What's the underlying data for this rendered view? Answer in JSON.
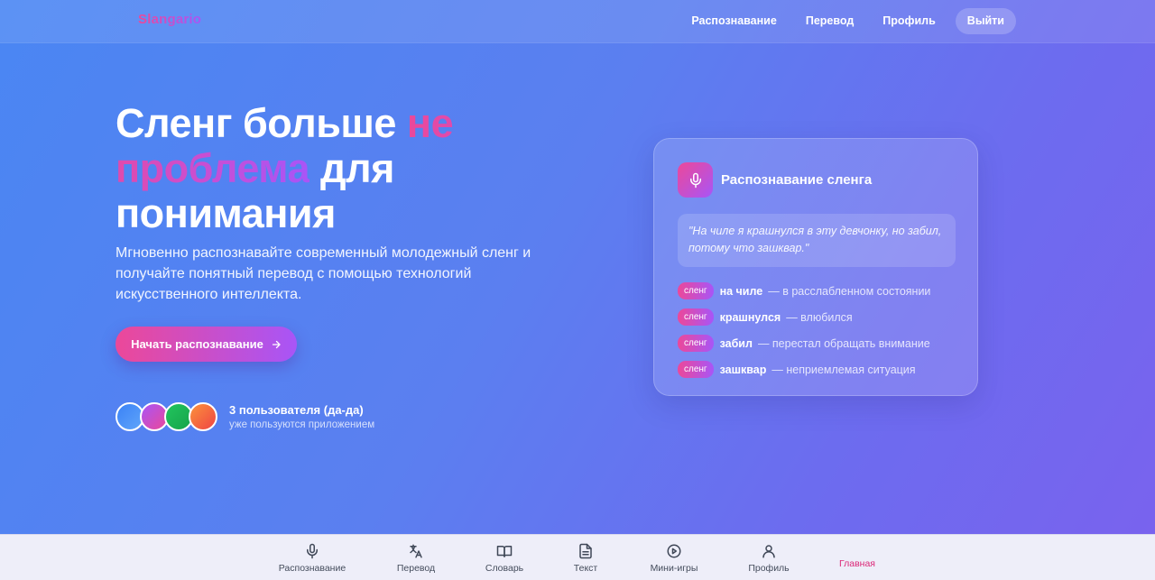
{
  "app": {
    "logo": "Slangario"
  },
  "topnav": {
    "links": [
      "Распознавание",
      "Перевод",
      "Профиль"
    ],
    "logout": "Выйти"
  },
  "hero": {
    "title_part1": "Сленг больше ",
    "title_accent": "не проблема",
    "title_part2": " для понимания",
    "subtitle": "Мгновенно распознавайте современный молодежный сленг и получайте понятный перевод с помощью технологий искусственного интеллекта.",
    "cta_label": "Начать распознавание",
    "users_title": "3 пользователя (да-да)",
    "users_sub": "уже пользуются приложением"
  },
  "card": {
    "title": "Распознавание сленга",
    "quote": "\"На чиле я крашнулся в эту девчонку, но забил, потому что зашквар.\"",
    "tag_label": "сленг",
    "items": [
      {
        "term": "на чиле",
        "definition": "— в расслабленном состоянии"
      },
      {
        "term": "крашнулся",
        "definition": "— влюбился"
      },
      {
        "term": "забил",
        "definition": "— перестал обращать внимание"
      },
      {
        "term": "зашквар",
        "definition": "— неприемлемая ситуация"
      }
    ]
  },
  "bottomnav": {
    "items": [
      {
        "label": "Распознавание",
        "icon": "mic-icon"
      },
      {
        "label": "Перевод",
        "icon": "translate-icon"
      },
      {
        "label": "Словарь",
        "icon": "book-icon"
      },
      {
        "label": "Текст",
        "icon": "document-icon"
      },
      {
        "label": "Мини-игры",
        "icon": "play-icon"
      },
      {
        "label": "Профиль",
        "icon": "user-icon"
      },
      {
        "label": "Главная",
        "icon": ""
      }
    ],
    "active": "Главная"
  },
  "colors": {
    "accent_pink": "#ec4899",
    "accent_purple": "#a855f7",
    "active_nav": "#db2777"
  }
}
